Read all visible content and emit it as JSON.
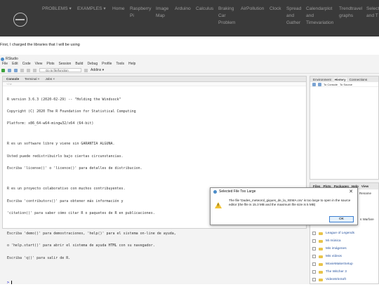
{
  "nav": {
    "items": [
      {
        "label": "PROBLEMS ▾"
      },
      {
        "label": "EXAMPLES ▾"
      },
      {
        "label": "Home"
      },
      {
        "label": "Raspberry Pi"
      },
      {
        "label": "Image Map"
      },
      {
        "label": "Arduino"
      },
      {
        "label": "Calculus"
      },
      {
        "label": "Braking Car Problem"
      },
      {
        "label": "AirPollution"
      },
      {
        "label": "Clock"
      },
      {
        "label": "Spread and Gather"
      },
      {
        "label": "Calendarplot and Timevariation"
      },
      {
        "label": "Trendtravel graphs"
      },
      {
        "label": "Select and T"
      }
    ]
  },
  "article": {
    "intro": "First, I charged the libraries that I will be using"
  },
  "rstudio": {
    "title": "RStudio",
    "menu": [
      "File",
      "Edit",
      "Code",
      "View",
      "Plots",
      "Session",
      "Build",
      "Debug",
      "Profile",
      "Tools",
      "Help"
    ],
    "goto_placeholder": "Go to file/function",
    "addins": "Addins ▾",
    "console_tabs": [
      "Console",
      "Terminal ×",
      "Jobs ×"
    ],
    "console_path": "~/ ⇨",
    "console_lines": [
      "R version 3.6.3 (2020-02-29) -- \"Holding the Windsock\"",
      "Copyright (C) 2020 The R Foundation for Statistical Computing",
      "Platform: x86_64-w64-mingw32/x64 (64-bit)",
      "",
      "R es un software libre y viene sin GARANTIA ALGUNA.",
      "Usted puede redistribuirlo bajo ciertas circunstancias.",
      "Escriba 'license()' o 'licence()' para detalles de distribucion.",
      "",
      "R es un proyecto colaborativo con muchos contribuyentes.",
      "Escriba 'contributors()' para obtener más información y",
      "'citation()' para saber cómo citar R o paquetes de R en publicaciones.",
      "",
      "Escriba 'demo()' para demostraciones, 'help()' para el sistema on-line de ayuda,",
      "o 'help.start()' para abrir el sistema de ayuda HTML con su navegador.",
      "Escriba 'q()' para salir de R."
    ],
    "prompt": ">",
    "env_tabs": [
      "Environment",
      "History",
      "Connections"
    ],
    "env_tools": [
      "To Console",
      "To Source"
    ],
    "files_tabs": [
      "Files",
      "Plots",
      "Packages",
      "Help",
      "View"
    ],
    "files_rename": "Rename",
    "files_partial": "s Warfare",
    "files": [
      "League of Legends",
      "Mi música",
      "Mis imágenes",
      "Mis vídeos",
      "MovieMakerSetup",
      "The Witcher 3",
      "VideoWinSoft"
    ]
  },
  "dialog": {
    "title": "Selected File Too Large",
    "close": "✕",
    "message": "The file 'Dades_meteorol_giques_de_la_XEMA.csv' is too large to open in the source editor (the file is 15.3 MB and the maximum file size is 5 MB)",
    "ok": "OK"
  }
}
